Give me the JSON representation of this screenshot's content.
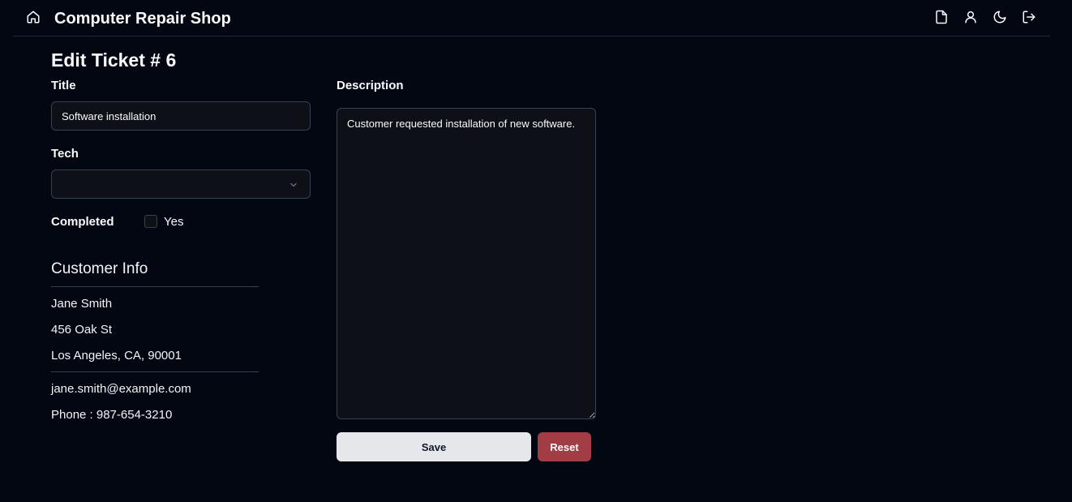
{
  "header": {
    "app_title": "Computer Repair Shop",
    "icons": [
      "home-icon",
      "file-icon",
      "user-icon",
      "moon-icon",
      "logout-icon"
    ]
  },
  "form": {
    "page_title": "Edit Ticket # 6",
    "title_label": "Title",
    "title_value": "Software installation",
    "tech_label": "Tech",
    "tech_selected": "",
    "completed_label": "Completed",
    "completed_option": "Yes",
    "completed_checked": false,
    "description_label": "Description",
    "description_value": "Customer requested installation of new software.",
    "save_label": "Save",
    "reset_label": "Reset"
  },
  "customer": {
    "heading": "Customer Info",
    "name": "Jane Smith",
    "address": "456 Oak St",
    "city_line": "Los Angeles, CA, 90001",
    "email": "jane.smith@example.com",
    "phone": "Phone : 987-654-3210"
  },
  "colors": {
    "background": "#030712",
    "input_bg": "#0d1017",
    "border": "#374151",
    "save_bg": "#e5e7eb",
    "reset_bg": "#a23c45"
  }
}
